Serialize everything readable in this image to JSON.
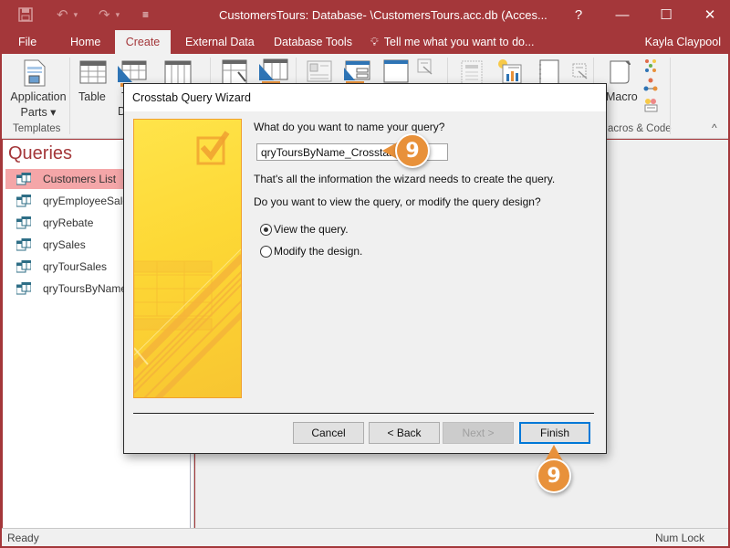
{
  "window": {
    "title": "CustomersTours: Database- \\CustomersTours.acc.db (Acces...",
    "help": "?",
    "minimize": "—",
    "maximize": "☐",
    "close": "✕"
  },
  "quick_access": {
    "save": "save-icon",
    "undo": "undo-icon",
    "redo": "redo-icon",
    "customize": "customize-icon"
  },
  "tabs": [
    {
      "label": "File"
    },
    {
      "label": "Home"
    },
    {
      "label": "Create",
      "active": true
    },
    {
      "label": "External Data"
    },
    {
      "label": "Database Tools"
    }
  ],
  "tell_me": "Tell me what you want to do...",
  "user": "Kayla Claypool",
  "ribbon": {
    "application_parts_line1": "Application",
    "application_parts_line2": "Parts ▾",
    "templates_group": "Templates",
    "table": "Table",
    "table_design_line1": "T",
    "table_design_line2": "De",
    "macro": "Macro",
    "macros_group": "acros & Code",
    "collapse": "^"
  },
  "nav": {
    "title": "Queries",
    "items": [
      {
        "label": "Customers List",
        "selected": true
      },
      {
        "label": "qryEmployeeSales"
      },
      {
        "label": "qryRebate"
      },
      {
        "label": "qrySales"
      },
      {
        "label": "qryTourSales"
      },
      {
        "label": "qryToursByName"
      }
    ]
  },
  "status": {
    "left": "Ready",
    "right": "Num Lock"
  },
  "dialog": {
    "title": "Crosstab Query Wizard",
    "question_name": "What do you want to name your query?",
    "query_name_value": "qryToursByName_Crosstab",
    "info": "That's all the information the wizard needs to create the query.",
    "question_view": "Do you want to view the query, or modify the query design?",
    "options": [
      {
        "label": "View the query.",
        "selected": true
      },
      {
        "label": "Modify the design.",
        "selected": false
      }
    ],
    "buttons": {
      "cancel": "Cancel",
      "back": "< Back",
      "next": "Next >",
      "finish": "Finish"
    }
  },
  "callouts": {
    "name_step": "9",
    "finish_step": "9"
  }
}
